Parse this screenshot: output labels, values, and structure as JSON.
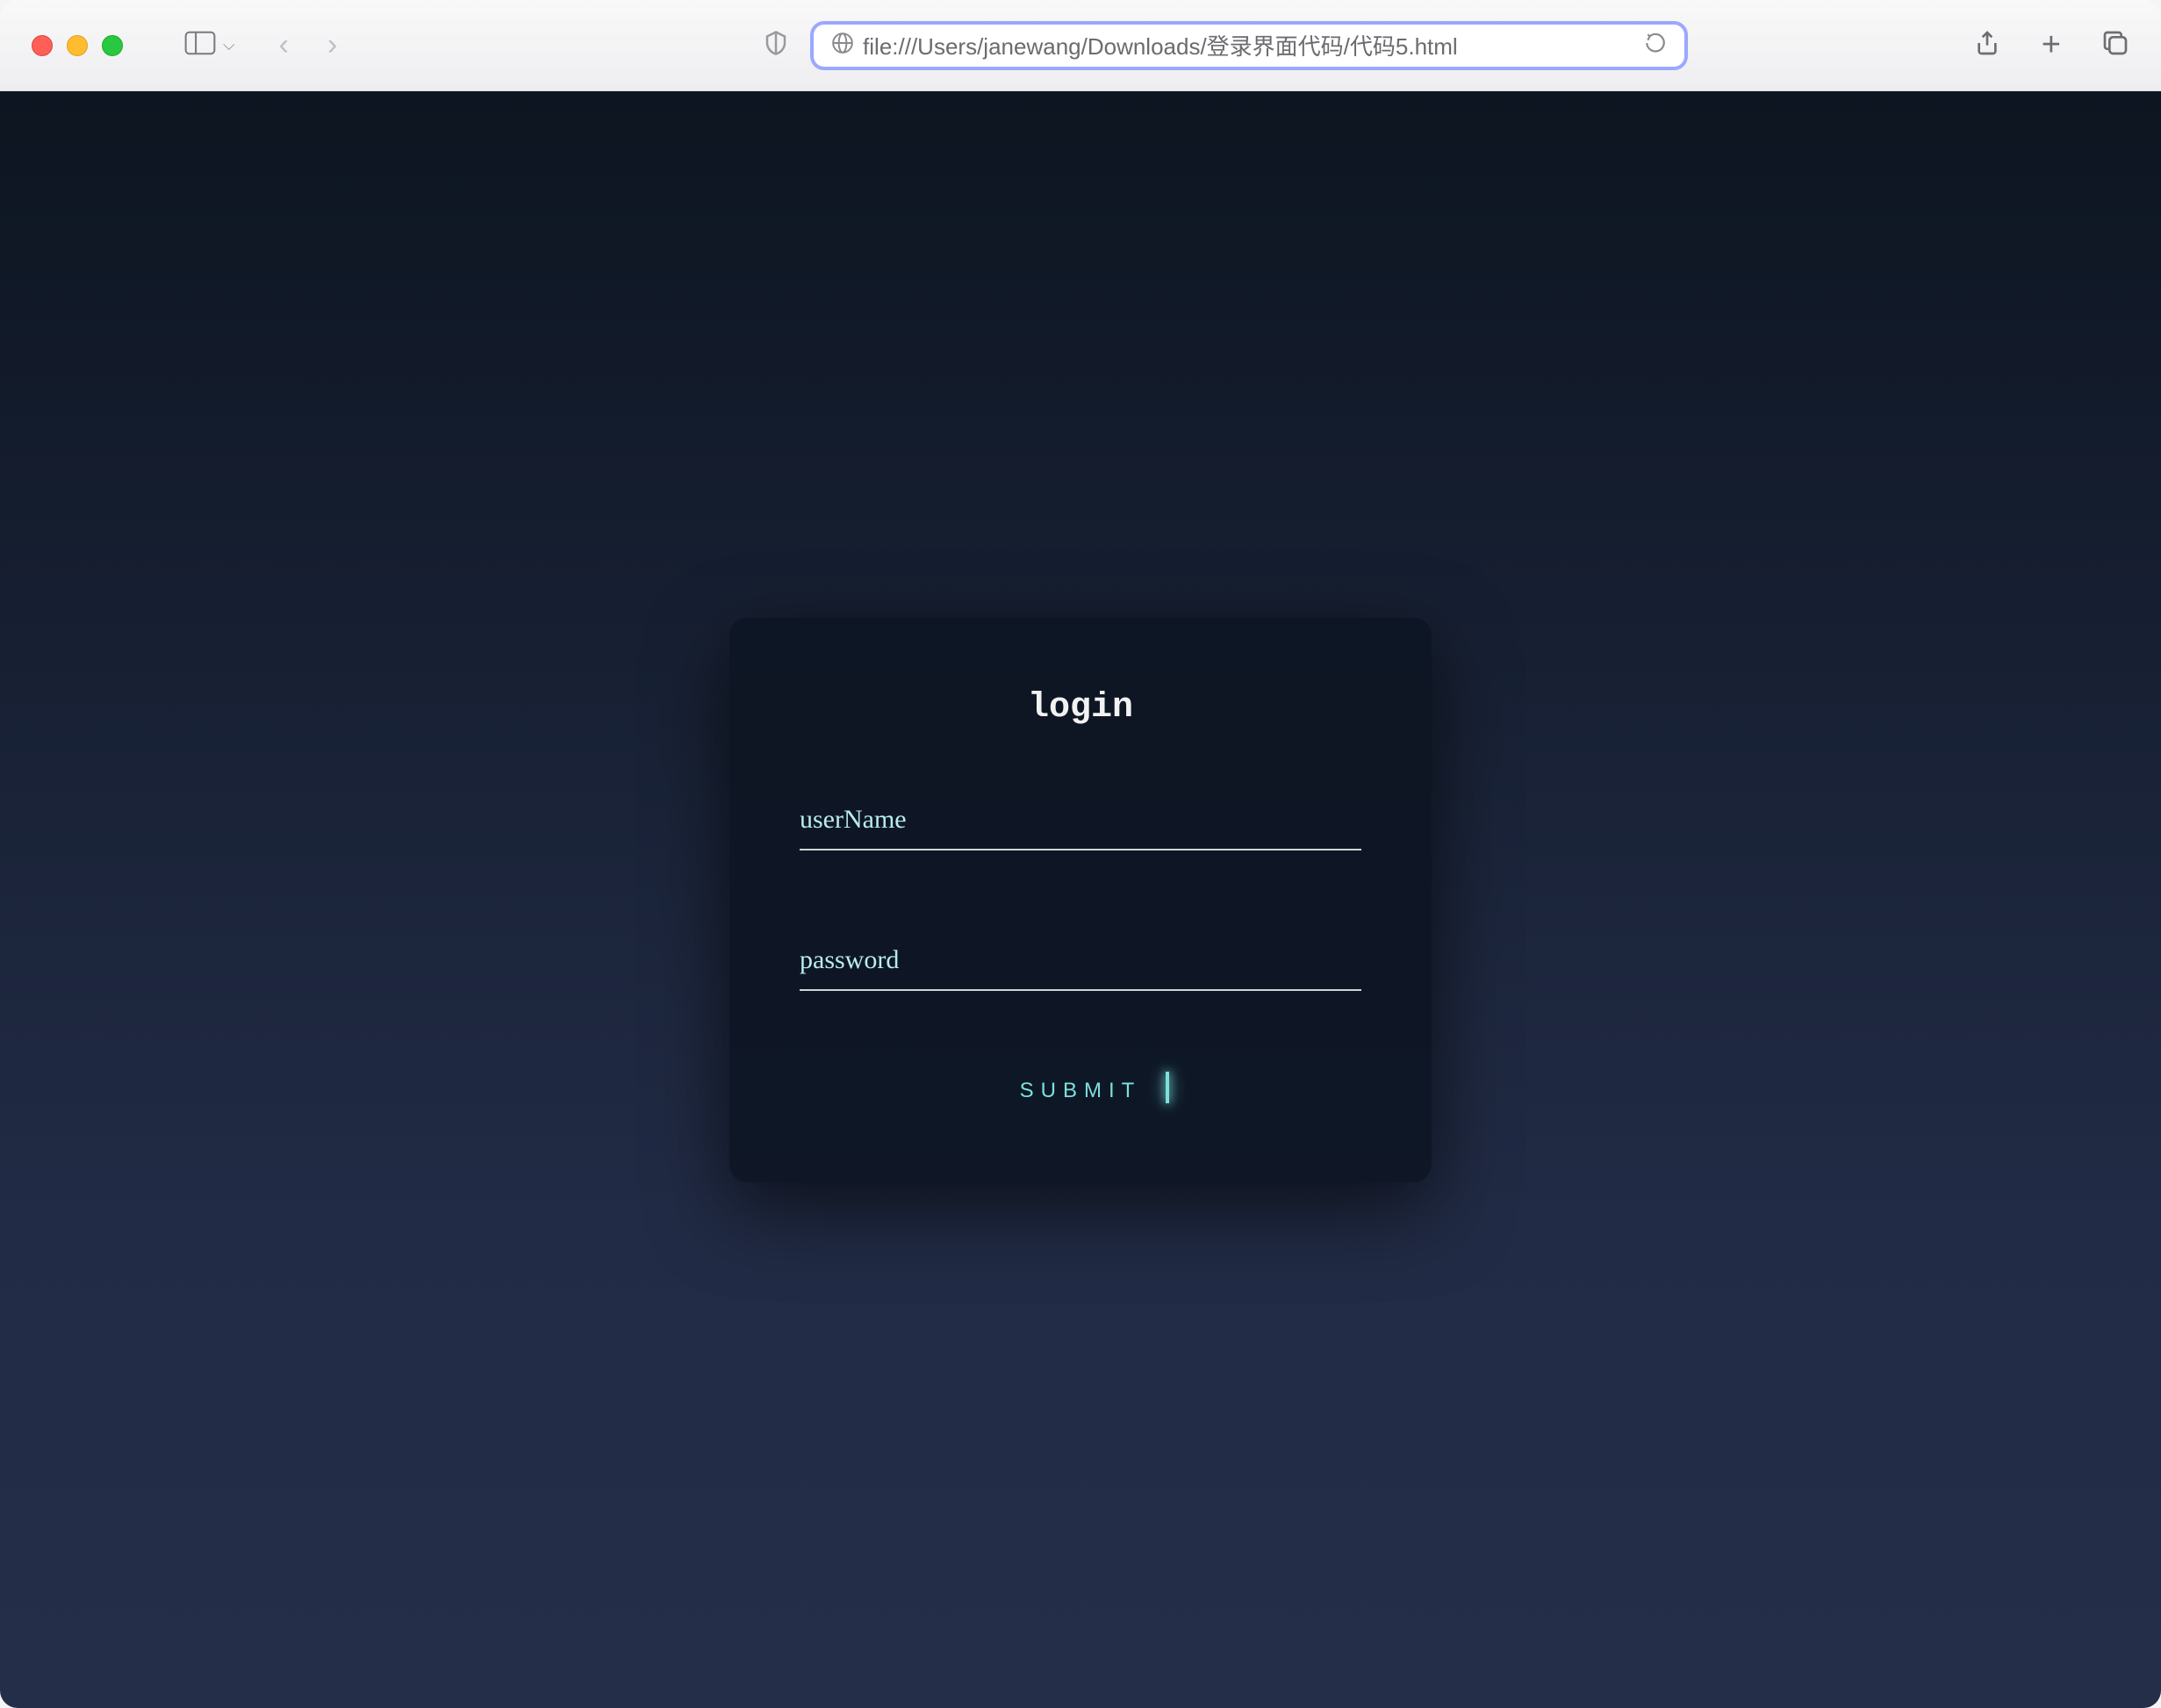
{
  "browser": {
    "url": "file:///Users/janewang/Downloads/登录界面代码/代码5.html"
  },
  "login": {
    "title": "login",
    "username_label": "userName",
    "username_value": "",
    "password_label": "password",
    "password_value": "",
    "submit_label": "SUBMIT"
  },
  "colors": {
    "accent": "#7de0dc",
    "address_ring": "#9aa8ff",
    "page_bg_top": "#0d1521",
    "page_bg_bottom": "#242e48",
    "box_bg": "rgba(12,20,34,0.88)"
  }
}
